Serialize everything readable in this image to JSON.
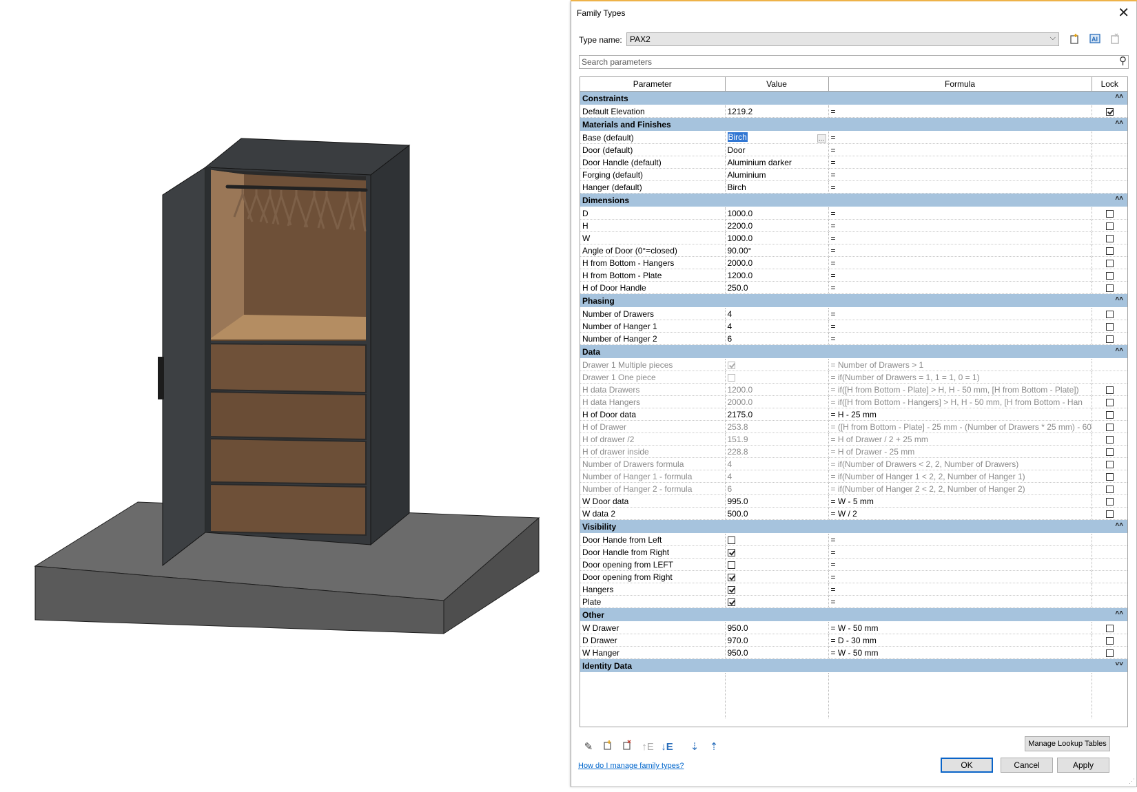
{
  "dialog": {
    "title": "Family Types",
    "type_name_label": "Type name:",
    "type_name_value": "PAX2",
    "search_placeholder": "Search parameters"
  },
  "columns": {
    "parameter": "Parameter",
    "value": "Value",
    "formula": "Formula",
    "lock": "Lock"
  },
  "groups": [
    {
      "name": "Constraints",
      "chevron": "˄˄",
      "rows": [
        {
          "param": "Default Elevation",
          "value": "1219.2",
          "formula": "=",
          "lock": "checked"
        }
      ]
    },
    {
      "name": "Materials and Finishes",
      "chevron": "˄˄",
      "rows": [
        {
          "param": "Base (default)",
          "value": "Birch",
          "formula": "=",
          "lock": "none",
          "selected": true
        },
        {
          "param": "Door (default)",
          "value": "Door",
          "formula": "=",
          "lock": "none"
        },
        {
          "param": "Door Handle (default)",
          "value": "Aluminium darker",
          "formula": "=",
          "lock": "none"
        },
        {
          "param": "Forging (default)",
          "value": "Aluminium",
          "formula": "=",
          "lock": "none"
        },
        {
          "param": "Hanger (default)",
          "value": "Birch",
          "formula": "=",
          "lock": "none"
        }
      ]
    },
    {
      "name": "Dimensions",
      "chevron": "˄˄",
      "rows": [
        {
          "param": "D",
          "value": "1000.0",
          "formula": "=",
          "lock": "unchecked"
        },
        {
          "param": "H",
          "value": "2200.0",
          "formula": "=",
          "lock": "unchecked"
        },
        {
          "param": "W",
          "value": "1000.0",
          "formula": "=",
          "lock": "unchecked"
        },
        {
          "param": "Angle of Door (0°=closed)",
          "value": "90.00°",
          "formula": "=",
          "lock": "unchecked"
        },
        {
          "param": "H from Bottom - Hangers",
          "value": "2000.0",
          "formula": "=",
          "lock": "unchecked"
        },
        {
          "param": "H from Bottom - Plate",
          "value": "1200.0",
          "formula": "=",
          "lock": "unchecked"
        },
        {
          "param": "H of Door Handle",
          "value": "250.0",
          "formula": "=",
          "lock": "unchecked"
        }
      ]
    },
    {
      "name": "Phasing",
      "chevron": "˄˄",
      "rows": [
        {
          "param": "Number of Drawers",
          "value": "4",
          "formula": "=",
          "lock": "unchecked"
        },
        {
          "param": "Number of Hanger 1",
          "value": "4",
          "formula": "=",
          "lock": "unchecked"
        },
        {
          "param": "Number of Hanger 2",
          "value": "6",
          "formula": "=",
          "lock": "unchecked"
        }
      ]
    },
    {
      "name": "Data",
      "chevron": "˄˄",
      "rows": [
        {
          "param": "Drawer 1 Multiple pieces",
          "valueCheck": "checked",
          "formula": "= Number of Drawers > 1",
          "lock": "none",
          "disabled": true
        },
        {
          "param": "Drawer 1 One piece",
          "valueCheck": "unchecked",
          "formula": "= if(Number of Drawers = 1, 1 = 1, 0 = 1)",
          "lock": "none",
          "disabled": true
        },
        {
          "param": "H data Drawers",
          "value": "1200.0",
          "formula": "= if([H from Bottom - Plate] > H, H - 50 mm, [H from Bottom - Plate])",
          "lock": "unchecked",
          "disabled": true
        },
        {
          "param": "H data Hangers",
          "value": "2000.0",
          "formula": "= if([H from Bottom - Hangers] > H, H - 50 mm, [H from Bottom - Han",
          "lock": "unchecked",
          "disabled": true
        },
        {
          "param": "H of Door data",
          "value": "2175.0",
          "formula": "= H - 25 mm",
          "lock": "unchecked"
        },
        {
          "param": "H of Drawer",
          "value": "253.8",
          "formula": "= ([H from Bottom - Plate] - 25 mm - (Number of Drawers * 25 mm) - 60",
          "lock": "unchecked",
          "disabled": true
        },
        {
          "param": "H of drawer /2",
          "value": "151.9",
          "formula": "= H of Drawer / 2 + 25 mm",
          "lock": "unchecked",
          "disabled": true
        },
        {
          "param": "H of drawer inside",
          "value": "228.8",
          "formula": "= H of Drawer - 25 mm",
          "lock": "unchecked",
          "disabled": true
        },
        {
          "param": "Number of Drawers  formula",
          "value": "4",
          "formula": "= if(Number of Drawers < 2, 2, Number of Drawers)",
          "lock": "unchecked",
          "disabled": true
        },
        {
          "param": "Number of Hanger 1 - formula",
          "value": "4",
          "formula": "= if(Number of Hanger 1 < 2, 2, Number of Hanger 1)",
          "lock": "unchecked",
          "disabled": true
        },
        {
          "param": "Number of Hanger 2 - formula",
          "value": "6",
          "formula": "= if(Number of Hanger 2 < 2, 2, Number of Hanger 2)",
          "lock": "unchecked",
          "disabled": true
        },
        {
          "param": "W Door data",
          "value": "995.0",
          "formula": "= W - 5 mm",
          "lock": "unchecked"
        },
        {
          "param": "W data 2",
          "value": "500.0",
          "formula": "= W / 2",
          "lock": "unchecked"
        }
      ]
    },
    {
      "name": "Visibility",
      "chevron": "˄˄",
      "rows": [
        {
          "param": "Door Hande from Left",
          "valueCheck": "unchecked",
          "formula": "=",
          "lock": "none"
        },
        {
          "param": "Door Handle from Right",
          "valueCheck": "checked",
          "formula": "=",
          "lock": "none"
        },
        {
          "param": "Door opening from LEFT",
          "valueCheck": "unchecked",
          "formula": "=",
          "lock": "none"
        },
        {
          "param": "Door opening from Right",
          "valueCheck": "checked",
          "formula": "=",
          "lock": "none"
        },
        {
          "param": "Hangers",
          "valueCheck": "checked",
          "formula": "=",
          "lock": "none"
        },
        {
          "param": "Plate",
          "valueCheck": "checked",
          "formula": "=",
          "lock": "none"
        }
      ]
    },
    {
      "name": "Other",
      "chevron": "˄˄",
      "rows": [
        {
          "param": "W Drawer",
          "value": "950.0",
          "formula": "= W - 50 mm",
          "lock": "unchecked"
        },
        {
          "param": "D Drawer",
          "value": "970.0",
          "formula": "= D - 30 mm",
          "lock": "unchecked"
        },
        {
          "param": "W Hanger",
          "value": "950.0",
          "formula": "= W - 50 mm",
          "lock": "unchecked"
        }
      ]
    },
    {
      "name": "Identity Data",
      "chevron": "˅˅",
      "rows": []
    }
  ],
  "buttons": {
    "manage_lookup": "Manage Lookup Tables",
    "help_link": "How do I manage family types?",
    "ok": "OK",
    "cancel": "Cancel",
    "apply": "Apply"
  },
  "icons": {
    "close": "close-icon",
    "new_type": "new-type-icon",
    "rename_type": "rename-type-icon",
    "delete_type": "delete-type-icon",
    "search": "search-icon"
  },
  "colors": {
    "group_header": "#a6c3dd",
    "selection": "#3277d3",
    "wardrobe_body": "#3c3f42",
    "wood": "#7a5a3d",
    "floor_slab": "#5e5e5e",
    "link": "#0066cc"
  }
}
